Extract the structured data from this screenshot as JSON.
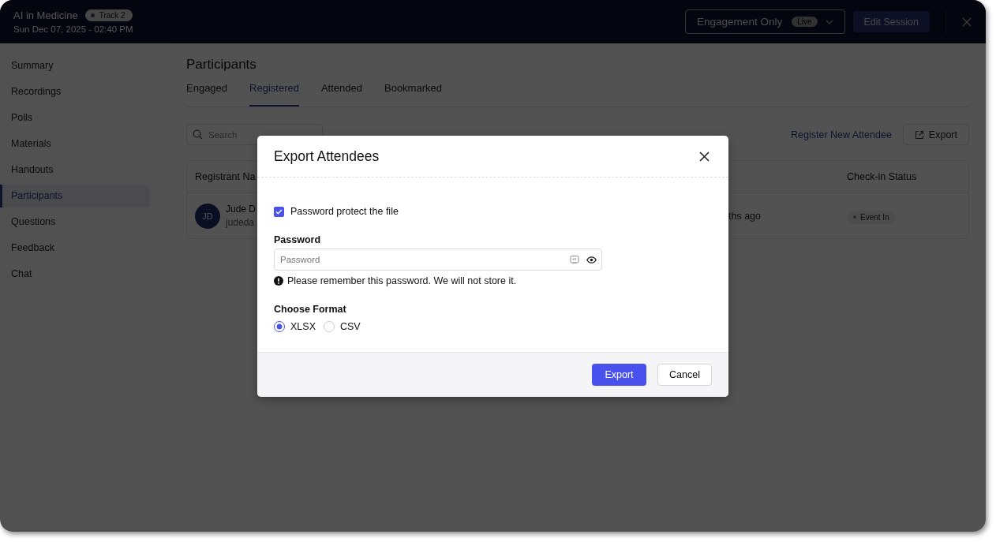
{
  "header": {
    "title": "AI in Medicine",
    "track_badge": "Track 2",
    "date": "Sun Dec 07, 2025 - 02:40 PM",
    "mode_select": {
      "label": "Engagement Only",
      "badge": "Live"
    },
    "edit_button": "Edit Session"
  },
  "sidebar": {
    "items": [
      {
        "label": "Summary",
        "selected": false
      },
      {
        "label": "Recordings",
        "selected": false
      },
      {
        "label": "Polls",
        "selected": false
      },
      {
        "label": "Materials",
        "selected": false
      },
      {
        "label": "Handouts",
        "selected": false
      },
      {
        "label": "Participants",
        "selected": true
      },
      {
        "label": "Questions",
        "selected": false
      },
      {
        "label": "Feedback",
        "selected": false
      },
      {
        "label": "Chat",
        "selected": false
      }
    ]
  },
  "page": {
    "title": "Participants",
    "tabs": [
      {
        "label": "Engaged",
        "selected": false
      },
      {
        "label": "Registered",
        "selected": true
      },
      {
        "label": "Attended",
        "selected": false
      },
      {
        "label": "Bookmarked",
        "selected": false
      }
    ],
    "search": {
      "placeholder": "Search"
    },
    "register_link": "Register New Attendee",
    "export_button": "Export",
    "table": {
      "columns": [
        "Registrant Na",
        "Check-in Status"
      ],
      "rows": [
        {
          "initials": "JD",
          "name": "Jude D",
          "email": "judeda",
          "column_3": "ths ago",
          "status": "Event In"
        }
      ]
    }
  },
  "modal": {
    "title": "Export Attendees",
    "protect": {
      "label": "Password protect the file",
      "checked": true
    },
    "password": {
      "label": "Password",
      "placeholder": "Password"
    },
    "note": "Please remember this password. We will not store it.",
    "format": {
      "label": "Choose Format",
      "options": [
        {
          "label": "XLSX",
          "selected": true
        },
        {
          "label": "CSV",
          "selected": false
        }
      ]
    },
    "export_button": "Export",
    "cancel_button": "Cancel"
  }
}
